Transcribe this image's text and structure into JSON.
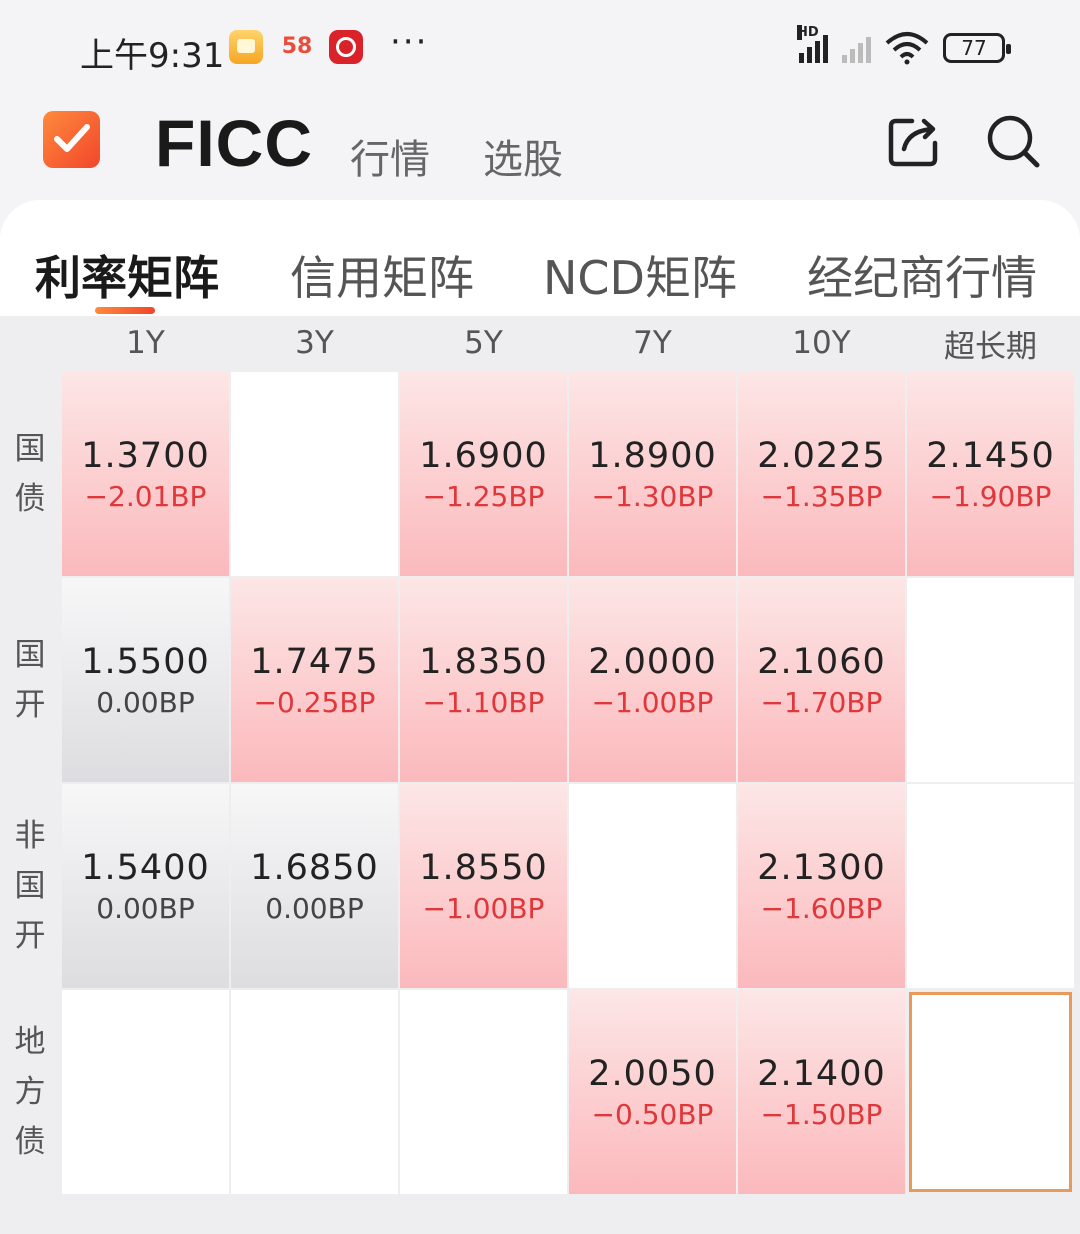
{
  "status_bar": {
    "time": "上午9:31",
    "app_badge_2": "58",
    "dots": "···",
    "network_label": "HD",
    "battery": "77"
  },
  "header": {
    "title": "FICC",
    "tabs": [
      "行情",
      "选股"
    ],
    "icons": [
      "share-icon",
      "search-icon"
    ],
    "brand_color": "#f2462a"
  },
  "matrix_tabs": [
    {
      "label": "利率矩阵",
      "active": true
    },
    {
      "label": "信用矩阵",
      "active": false
    },
    {
      "label": "NCD矩阵",
      "active": false
    },
    {
      "label": "经纪商行情",
      "active": false
    }
  ],
  "grid": {
    "columns": [
      "1Y",
      "3Y",
      "5Y",
      "7Y",
      "10Y",
      "超长期"
    ],
    "rows": [
      {
        "label": [
          "国",
          "债"
        ],
        "cells": [
          {
            "value": "1.3700",
            "change": "−2.01BP",
            "tone": "red"
          },
          {
            "value": "",
            "change": "",
            "tone": "empty"
          },
          {
            "value": "1.6900",
            "change": "−1.25BP",
            "tone": "red"
          },
          {
            "value": "1.8900",
            "change": "−1.30BP",
            "tone": "red"
          },
          {
            "value": "2.0225",
            "change": "−1.35BP",
            "tone": "red"
          },
          {
            "value": "2.1450",
            "change": "−1.90BP",
            "tone": "red"
          }
        ]
      },
      {
        "label": [
          "国",
          "开"
        ],
        "cells": [
          {
            "value": "1.5500",
            "change": "0.00BP",
            "tone": "gray"
          },
          {
            "value": "1.7475",
            "change": "−0.25BP",
            "tone": "red"
          },
          {
            "value": "1.8350",
            "change": "−1.10BP",
            "tone": "red"
          },
          {
            "value": "2.0000",
            "change": "−1.00BP",
            "tone": "red"
          },
          {
            "value": "2.1060",
            "change": "−1.70BP",
            "tone": "red"
          },
          {
            "value": "",
            "change": "",
            "tone": "empty"
          }
        ]
      },
      {
        "label": [
          "非",
          "国",
          "开"
        ],
        "cells": [
          {
            "value": "1.5400",
            "change": "0.00BP",
            "tone": "gray"
          },
          {
            "value": "1.6850",
            "change": "0.00BP",
            "tone": "gray"
          },
          {
            "value": "1.8550",
            "change": "−1.00BP",
            "tone": "red"
          },
          {
            "value": "",
            "change": "",
            "tone": "empty"
          },
          {
            "value": "2.1300",
            "change": "−1.60BP",
            "tone": "red"
          },
          {
            "value": "",
            "change": "",
            "tone": "empty"
          }
        ]
      },
      {
        "label": [
          "地",
          "方",
          "债"
        ],
        "cells": [
          {
            "value": "",
            "change": "",
            "tone": "empty"
          },
          {
            "value": "",
            "change": "",
            "tone": "empty"
          },
          {
            "value": "",
            "change": "",
            "tone": "empty"
          },
          {
            "value": "2.0050",
            "change": "−0.50BP",
            "tone": "red"
          },
          {
            "value": "2.1400",
            "change": "−1.50BP",
            "tone": "red"
          },
          {
            "value": "",
            "change": "",
            "tone": "selected"
          }
        ]
      }
    ]
  },
  "colors": {
    "negative": "#e0373b",
    "cell_red": "#fbb9bc",
    "cell_gray": "#dddde0",
    "selection": "#e79a5b"
  }
}
